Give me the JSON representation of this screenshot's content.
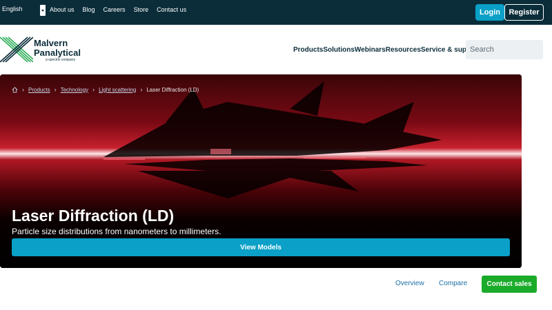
{
  "topbar": {
    "language": "English",
    "links": [
      "About us",
      "Blog",
      "Careers",
      "Store",
      "Contact us"
    ],
    "login_label": "Login",
    "register_label": "Register"
  },
  "header": {
    "logo_line1": "Malvern",
    "logo_line2": "Panalytical",
    "logo_sub": "a spectris company",
    "nav": [
      "Products",
      "Solutions",
      "Webinars",
      "Resources",
      "Service & support"
    ],
    "search_placeholder": "Search"
  },
  "breadcrumb": {
    "items": [
      "Products",
      "Technology",
      "Light scattering"
    ],
    "current": "Laser Diffraction (LD)"
  },
  "hero": {
    "title": "Laser Diffraction (LD)",
    "subtitle": "Particle size distributions from nanometers to millimeters.",
    "cta_label": "View Models"
  },
  "subnav": {
    "overview_label": "Overview",
    "compare_label": "Compare",
    "contact_label": "Contact sales"
  },
  "colors": {
    "topbar_bg": "#0b2d3a",
    "accent_blue": "#0aa0c7",
    "contact_green": "#1bab2b",
    "logo_green": "#2fae5a"
  }
}
